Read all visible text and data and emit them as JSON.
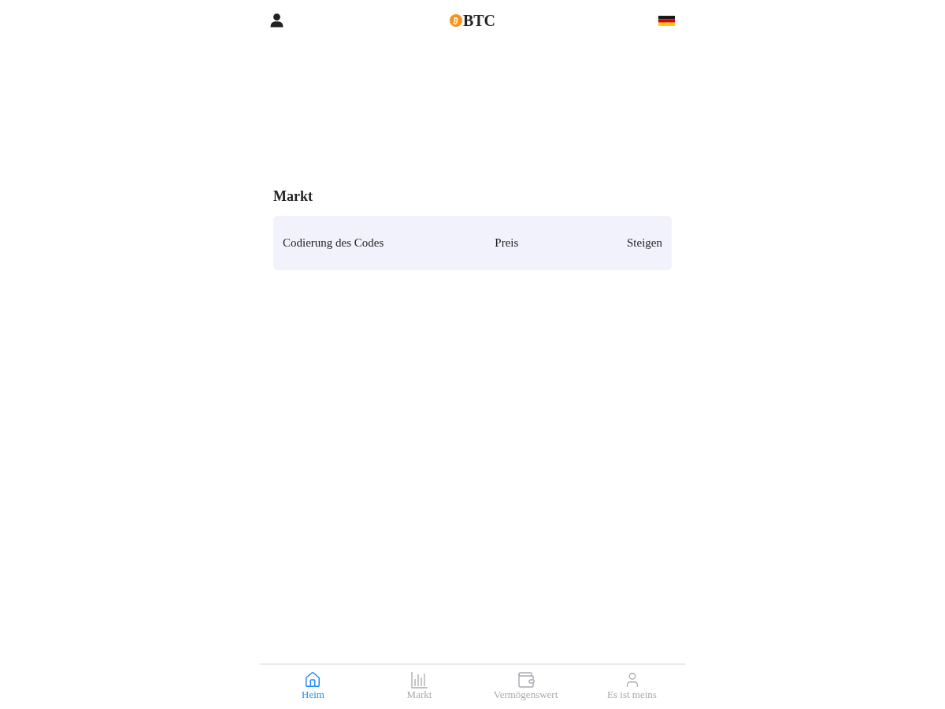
{
  "header": {
    "title": "BTC"
  },
  "market": {
    "title": "Markt",
    "columns": [
      "Codierung des Codes",
      "Preis",
      "Steigen"
    ]
  },
  "tab_bar": [
    {
      "label": "Heim",
      "selected": true
    },
    {
      "label": "Markt",
      "selected": false
    },
    {
      "label": "Vermögenswert",
      "selected": false
    },
    {
      "label": "Es ist meins",
      "selected": false
    }
  ]
}
